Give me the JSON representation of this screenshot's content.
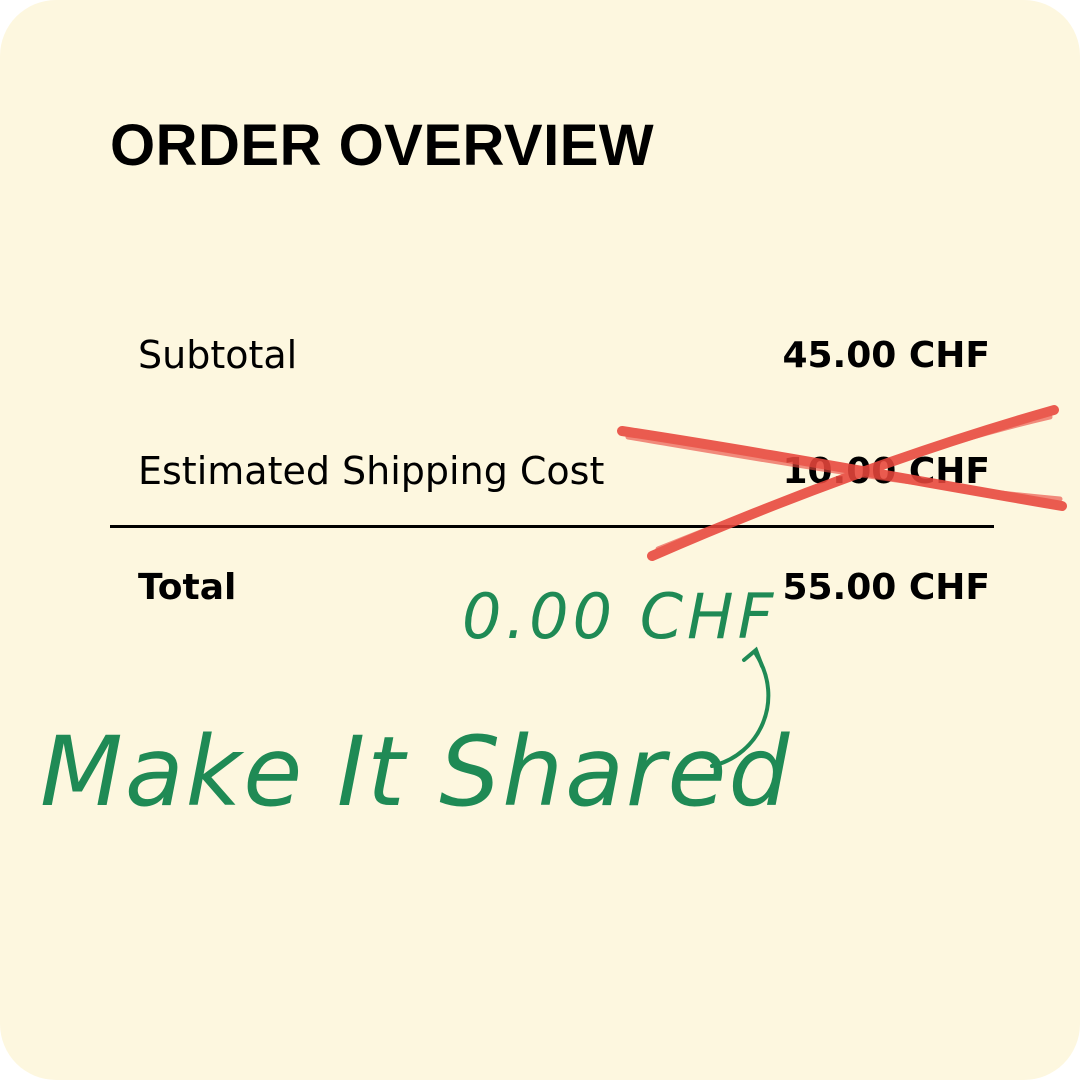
{
  "title": "ORDER OVERVIEW",
  "rows": [
    {
      "label": "Subtotal",
      "value": "45.00 CHF"
    },
    {
      "label": "Estimated Shipping Cost",
      "value": "10.00 CHF"
    }
  ],
  "total": {
    "label": "Total",
    "value": "55.00 CHF"
  },
  "handwritten": {
    "new_shipping": "0.00 CHF",
    "slogan": "Make It Shared"
  },
  "colors": {
    "background": "#fdf7df",
    "text": "#000000",
    "strike": "#e8463c",
    "handwriting": "#1f8a55"
  }
}
